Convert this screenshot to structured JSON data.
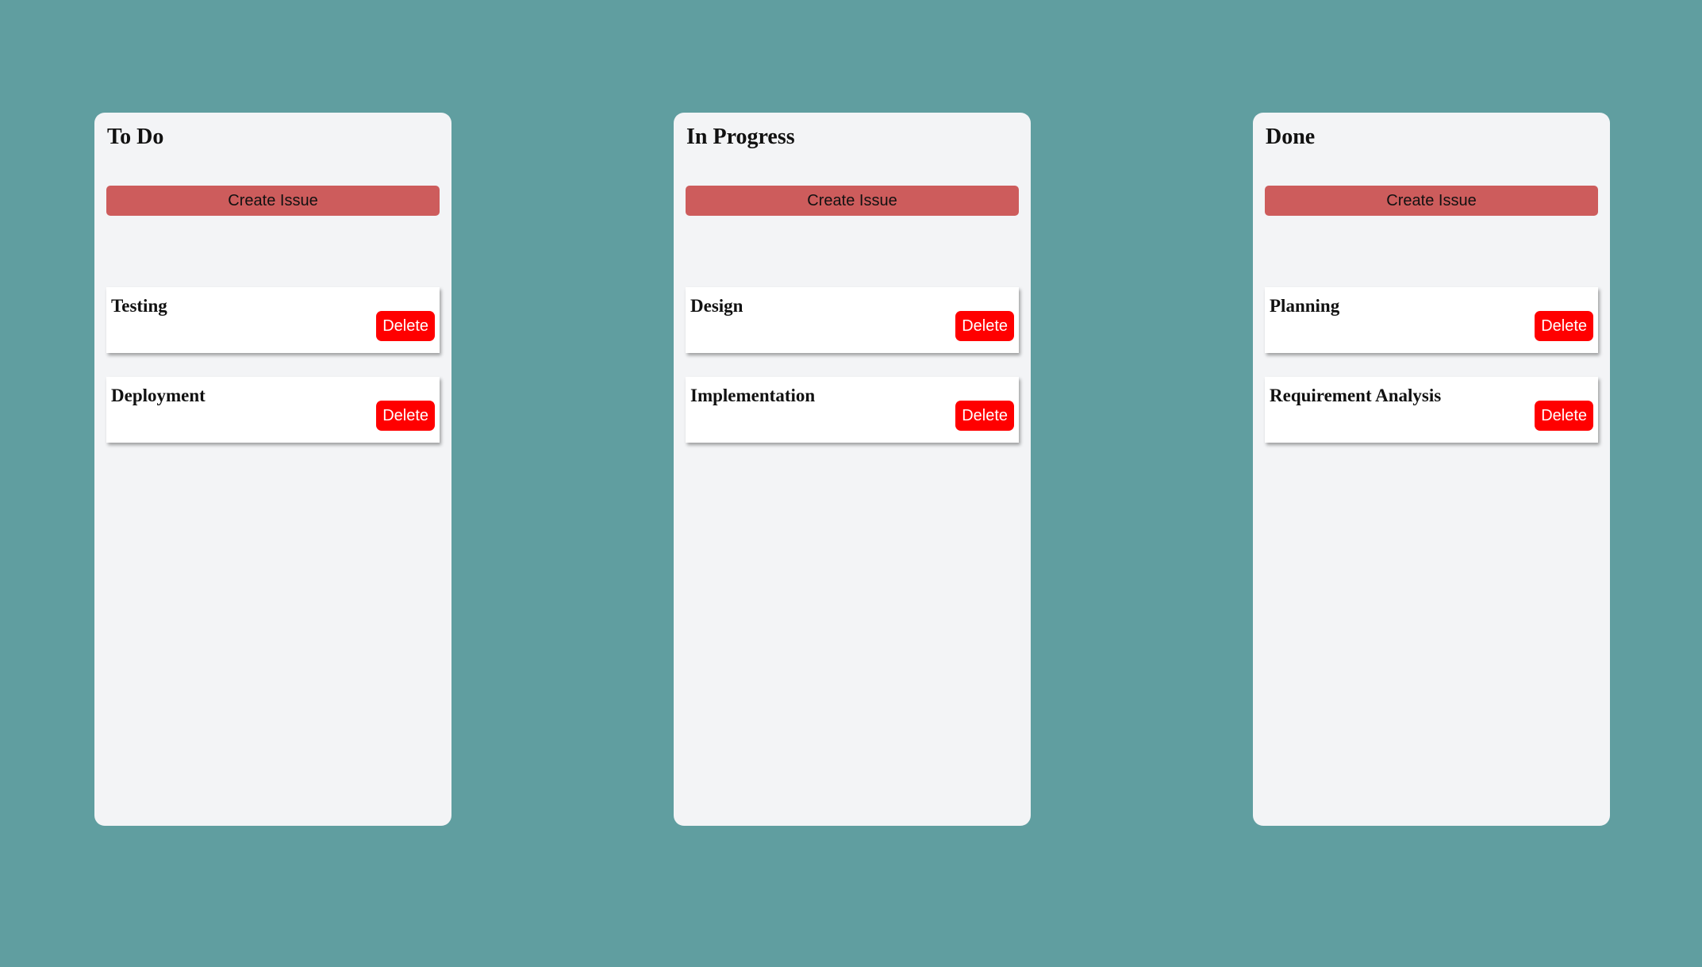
{
  "board": {
    "columns": [
      {
        "title": "To Do",
        "create_label": "Create Issue",
        "cards": [
          {
            "title": "Testing",
            "delete_label": "Delete"
          },
          {
            "title": "Deployment",
            "delete_label": "Delete"
          }
        ]
      },
      {
        "title": "In Progress",
        "create_label": "Create Issue",
        "cards": [
          {
            "title": "Design",
            "delete_label": "Delete"
          },
          {
            "title": "Implementation",
            "delete_label": "Delete"
          }
        ]
      },
      {
        "title": "Done",
        "create_label": "Create Issue",
        "cards": [
          {
            "title": "Planning",
            "delete_label": "Delete"
          },
          {
            "title": "Requirement Analysis",
            "delete_label": "Delete"
          }
        ]
      }
    ]
  },
  "colors": {
    "background": "#609ea0",
    "column": "#f3f4f6",
    "create_button": "#cd5c5c",
    "delete_button": "#ff0000"
  }
}
